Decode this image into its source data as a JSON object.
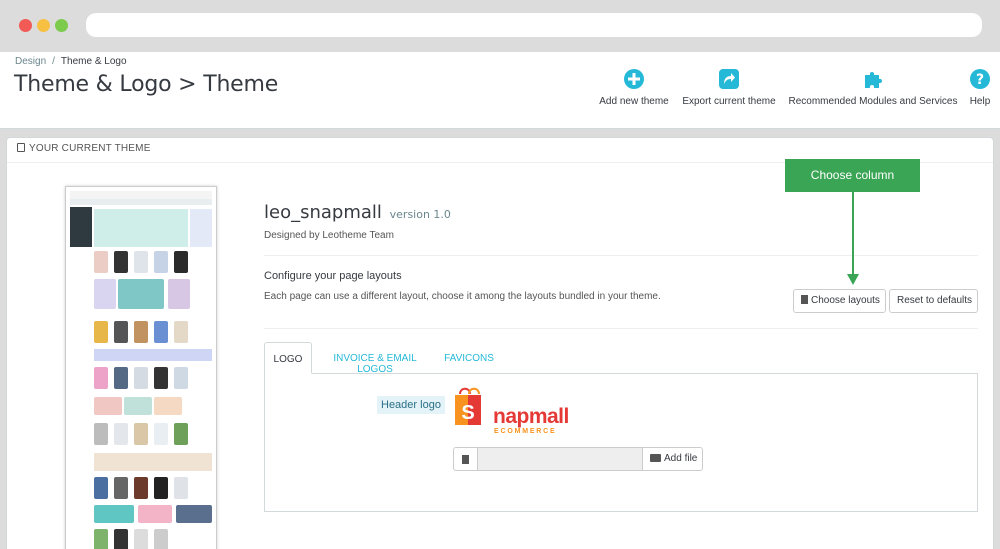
{
  "breadcrumb": {
    "parent": "Design",
    "separator": "/",
    "current": "Theme & Logo"
  },
  "page": {
    "title": "Theme & Logo > Theme"
  },
  "toolbar": {
    "add": "Add new theme",
    "export": "Export current theme",
    "recommended": "Recommended Modules and Services",
    "help": "Help",
    "icon_color": "#25b9d7"
  },
  "panel": {
    "heading": "YOUR CURRENT THEME"
  },
  "theme": {
    "name": "leo_snapmall",
    "version": "version 1.0",
    "designed_by": "Designed by Leotheme Team"
  },
  "layouts": {
    "title": "Configure your page layouts",
    "description": "Each page can use a different layout, choose it among the layouts bundled in your theme.",
    "choose_button": "Choose layouts",
    "reset_button": "Reset to defaults"
  },
  "annotation": {
    "text": "Choose column",
    "color": "#3aa555"
  },
  "tabs": [
    {
      "label": "LOGO",
      "active": true
    },
    {
      "label": "INVOICE & EMAIL LOGOS",
      "active": false
    },
    {
      "label": "FAVICONS",
      "active": false
    }
  ],
  "logo_tab": {
    "label": "Header logo",
    "logo_name": "napmall",
    "logo_letter": "S",
    "logo_sub": "ECOMMERCE",
    "add_file": "Add file"
  }
}
